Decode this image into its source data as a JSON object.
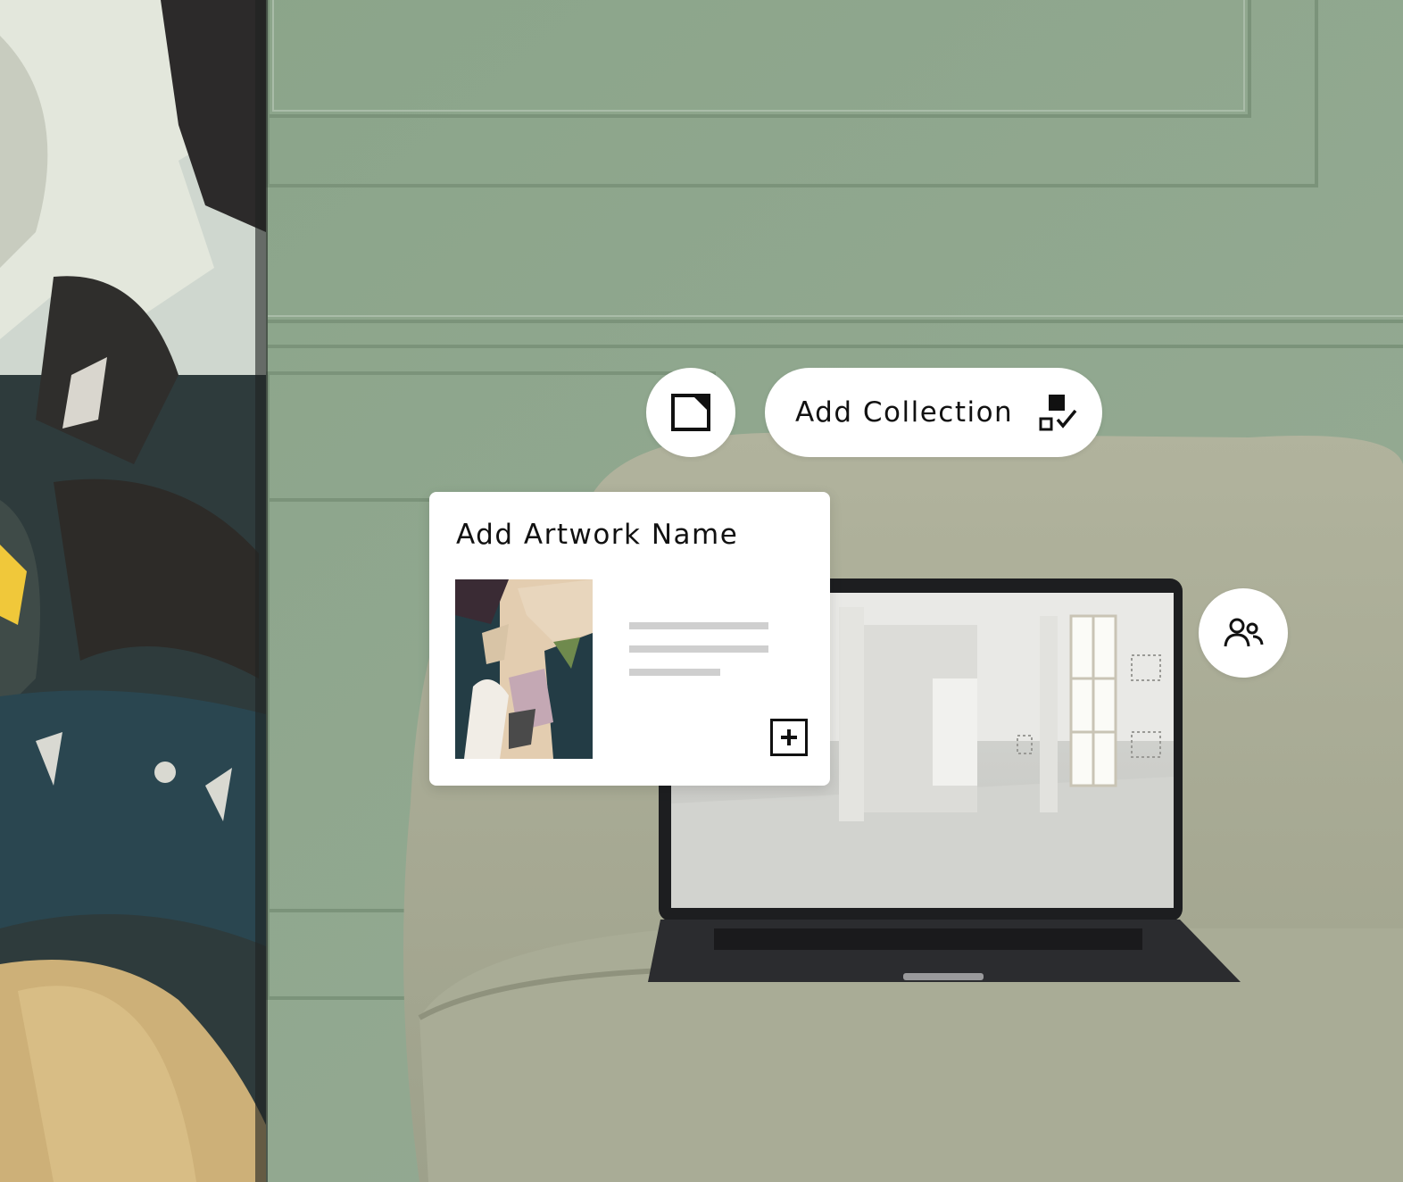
{
  "toolbar": {
    "frame_button_icon": "frame-corner-icon",
    "add_collection_label": "Add Collection",
    "add_collection_icon": "collection-check-icon",
    "users_button_icon": "users-icon"
  },
  "artwork_card": {
    "title": "Add Artwork Name",
    "thumbnail": "abstract-painting-thumbnail",
    "add_icon": "plus-square-icon"
  },
  "colors": {
    "wall": "#8fa78f",
    "chair": "#a7ab93",
    "chip_background": "#ffffff",
    "text": "#111111",
    "placeholder_lines": "#cfcfcf"
  }
}
